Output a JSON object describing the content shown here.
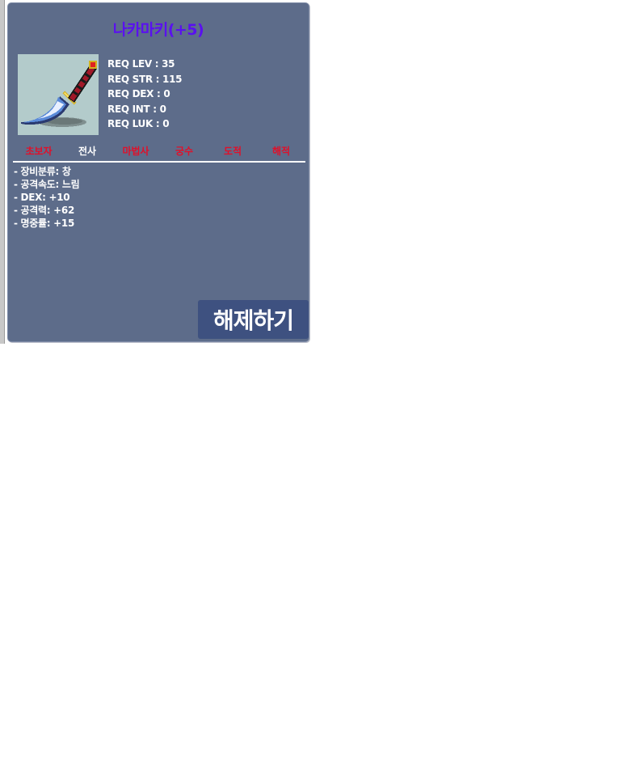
{
  "item": {
    "name": "나카마키(+5)",
    "name_color": "#5a10f0",
    "icon": "dagger-weapon-icon"
  },
  "requirements": [
    "REQ LEV : 35",
    "REQ STR : 115",
    "REQ DEX : 0",
    "REQ INT : 0",
    "REQ LUK : 0"
  ],
  "jobs": [
    {
      "label": "초보자",
      "color": "#e0102a"
    },
    {
      "label": "전사",
      "color": "#ffffff"
    },
    {
      "label": "마법사",
      "color": "#e0102a"
    },
    {
      "label": "궁수",
      "color": "#e0102a"
    },
    {
      "label": "도적",
      "color": "#e0102a"
    },
    {
      "label": "해적",
      "color": "#e0102a"
    }
  ],
  "stats": [
    "- 장비분류: 창",
    "- 공격속도: 느림",
    "- DEX: +10",
    "- 공격력: +62",
    "- 명중률: +15"
  ],
  "actions": {
    "unequip_label": "해제하기"
  },
  "colors": {
    "panel_bg": "#5d6c8a",
    "button_bg": "#3e5180",
    "job_available": "#ffffff",
    "job_unavailable": "#e0102a"
  }
}
